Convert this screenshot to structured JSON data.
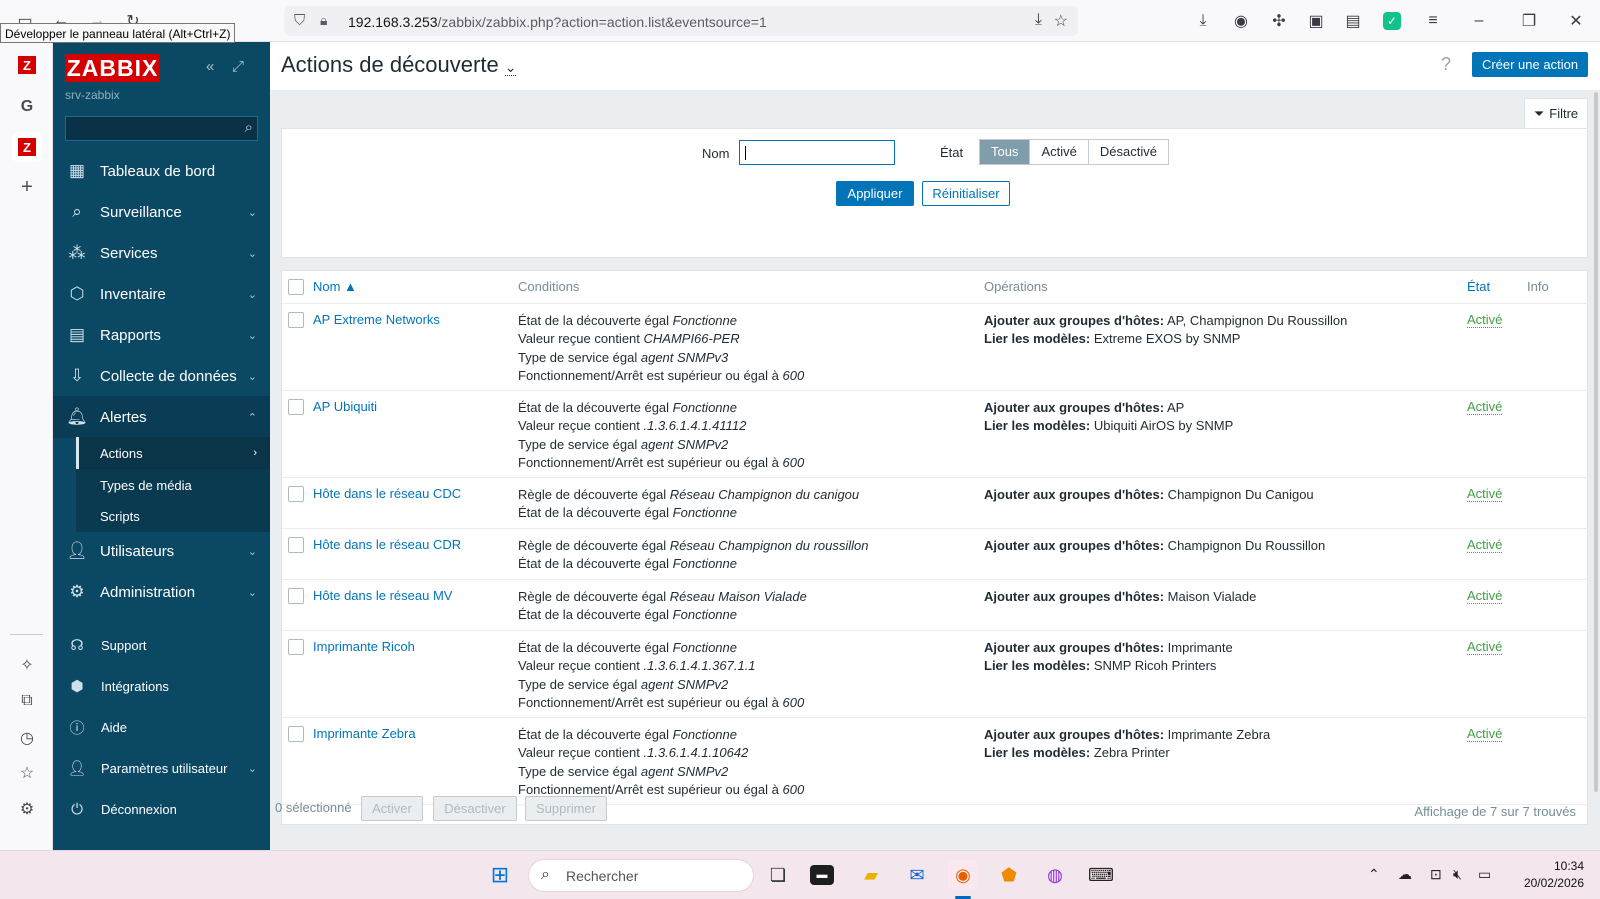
{
  "browser": {
    "url_host": "192.168.3.253",
    "url_path": "/zabbix/zabbix.php?action=action.list&eventsource=1",
    "tooltip": "Développer le panneau latéral (Alt+Ctrl+Z)"
  },
  "sidebar": {
    "logo": "ZABBIX",
    "server": "srv-zabbix",
    "search_placeholder": "",
    "menu": [
      {
        "label": "Tableaux de bord",
        "icon": "dashboard-icon"
      },
      {
        "label": "Surveillance",
        "icon": "monitoring-icon"
      },
      {
        "label": "Services",
        "icon": "services-icon"
      },
      {
        "label": "Inventaire",
        "icon": "inventory-icon"
      },
      {
        "label": "Rapports",
        "icon": "reports-icon"
      },
      {
        "label": "Collecte de données",
        "icon": "data-collection-icon"
      },
      {
        "label": "Alertes",
        "icon": "bell-icon"
      },
      {
        "label": "Utilisateurs",
        "icon": "users-icon"
      },
      {
        "label": "Administration",
        "icon": "gear-icon"
      }
    ],
    "alert_sub": [
      "Actions",
      "Types de média",
      "Scripts"
    ],
    "utilities": [
      "Support",
      "Intégrations",
      "Aide",
      "Paramètres utilisateur",
      "Déconnexion"
    ]
  },
  "page": {
    "title": "Actions de découverte",
    "create_button": "Créer une action",
    "help": "?",
    "filter_tab": "Filtre"
  },
  "filter": {
    "name_label": "Nom",
    "name_value": "",
    "state_label": "État",
    "state_options": [
      "Tous",
      "Activé",
      "Désactivé"
    ],
    "state_selected": "Tous",
    "apply": "Appliquer",
    "reset": "Réinitialiser"
  },
  "table": {
    "headers": {
      "name": "Nom ▲",
      "conditions": "Conditions",
      "operations": "Opérations",
      "state": "État",
      "info": "Info"
    },
    "rows": [
      {
        "name": "AP Extreme Networks",
        "conditions": [
          {
            "text": "État de la découverte égal ",
            "value": "Fonctionne"
          },
          {
            "text": "Valeur reçue contient ",
            "value": "CHAMPI66-PER"
          },
          {
            "text": "Type de service égal ",
            "value": "agent SNMPv3"
          },
          {
            "text": "Fonctionnement/Arrêt est supérieur ou égal à ",
            "value": "600"
          }
        ],
        "operations": [
          {
            "label": "Ajouter aux groupes d'hôtes:",
            "value": " AP, Champignon Du Roussillon"
          },
          {
            "label": "Lier les modèles:",
            "value": " Extreme EXOS by SNMP"
          }
        ],
        "state": "Activé"
      },
      {
        "name": "AP Ubiquiti",
        "conditions": [
          {
            "text": "État de la découverte égal ",
            "value": "Fonctionne"
          },
          {
            "text": "Valeur reçue contient ",
            "value": ".1.3.6.1.4.1.41112"
          },
          {
            "text": "Type de service égal ",
            "value": "agent SNMPv2"
          },
          {
            "text": "Fonctionnement/Arrêt est supérieur ou égal à ",
            "value": "600"
          }
        ],
        "operations": [
          {
            "label": "Ajouter aux groupes d'hôtes:",
            "value": " AP"
          },
          {
            "label": "Lier les modèles:",
            "value": " Ubiquiti AirOS by SNMP"
          }
        ],
        "state": "Activé"
      },
      {
        "name": "Hôte dans le réseau CDC",
        "conditions": [
          {
            "text": "Règle de découverte égal ",
            "value": "Réseau Champignon du canigou"
          },
          {
            "text": "État de la découverte égal ",
            "value": "Fonctionne"
          }
        ],
        "operations": [
          {
            "label": "Ajouter aux groupes d'hôtes:",
            "value": " Champignon Du Canigou"
          }
        ],
        "state": "Activé"
      },
      {
        "name": "Hôte dans le réseau CDR",
        "conditions": [
          {
            "text": "Règle de découverte égal ",
            "value": "Réseau Champignon du roussillon"
          },
          {
            "text": "État de la découverte égal ",
            "value": "Fonctionne"
          }
        ],
        "operations": [
          {
            "label": "Ajouter aux groupes d'hôtes:",
            "value": " Champignon Du Roussillon"
          }
        ],
        "state": "Activé"
      },
      {
        "name": "Hôte dans le réseau MV",
        "conditions": [
          {
            "text": "Règle de découverte égal ",
            "value": "Réseau Maison Vialade"
          },
          {
            "text": "État de la découverte égal ",
            "value": "Fonctionne"
          }
        ],
        "operations": [
          {
            "label": "Ajouter aux groupes d'hôtes:",
            "value": " Maison Vialade"
          }
        ],
        "state": "Activé"
      },
      {
        "name": "Imprimante Ricoh",
        "conditions": [
          {
            "text": "État de la découverte égal ",
            "value": "Fonctionne"
          },
          {
            "text": "Valeur reçue contient ",
            "value": ".1.3.6.1.4.1.367.1.1"
          },
          {
            "text": "Type de service égal ",
            "value": "agent SNMPv2"
          },
          {
            "text": "Fonctionnement/Arrêt est supérieur ou égal à ",
            "value": "600"
          }
        ],
        "operations": [
          {
            "label": "Ajouter aux groupes d'hôtes:",
            "value": " Imprimante"
          },
          {
            "label": "Lier les modèles:",
            "value": " SNMP Ricoh Printers"
          }
        ],
        "state": "Activé"
      },
      {
        "name": "Imprimante Zebra",
        "conditions": [
          {
            "text": "État de la découverte égal ",
            "value": "Fonctionne"
          },
          {
            "text": "Valeur reçue contient ",
            "value": ".1.3.6.1.4.1.10642"
          },
          {
            "text": "Type de service égal ",
            "value": "agent SNMPv2"
          },
          {
            "text": "Fonctionnement/Arrêt est supérieur ou égal à ",
            "value": "600"
          }
        ],
        "operations": [
          {
            "label": "Ajouter aux groupes d'hôtes:",
            "value": " Imprimante Zebra"
          },
          {
            "label": "Lier les modèles:",
            "value": " Zebra Printer"
          }
        ],
        "state": "Activé"
      }
    ],
    "count_text": "Affichage de 7 sur 7 trouvés"
  },
  "bulk": {
    "selected": "0 sélectionné",
    "enable": "Activer",
    "disable": "Désactiver",
    "delete": "Supprimer"
  },
  "taskbar": {
    "search": "Rechercher",
    "time": "10:34",
    "date": "20/02/2026"
  },
  "colors": {
    "sidebar": "#0b4864",
    "logo": "#d40000",
    "primary": "#0275b8",
    "enabled": "#429e47"
  }
}
